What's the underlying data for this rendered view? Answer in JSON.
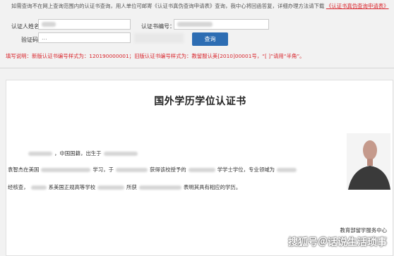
{
  "notice": {
    "text": "如需查询不在网上查询范围内的认证书查询，用人单位可邮寄《认证书真伪查询申请表》查询，我中心将回函答复，详细办理方法请下载",
    "link_label": "《认证书真伪查询申请表》"
  },
  "form": {
    "name_label": "认证人姓名：",
    "cert_no_label": "认证书编号：",
    "captcha_label": "验证码：",
    "captcha_value": "...",
    "search_label": "查询"
  },
  "hint": "填写说明：新版认证书编号样式为：120190000001；旧版认证书编号样式为：教留服认美[2010]00001号，“[ ]”请用“半角”。",
  "certificate": {
    "title": "国外学历学位认证书",
    "line1_a": "，中国国籍，出生于",
    "line2_a": "袁智杰在美国",
    "line2_b": "学习，于",
    "line2_c": "获得该校授予的",
    "line2_d": "学学士学位，专业领域为",
    "line3_a": "经核查，",
    "line3_b": "系美国正规高等学校",
    "line3_c": "所获",
    "line3_d": "表明其具有相应的学历。",
    "issuer": "教育部留学服务中心"
  },
  "watermark": "搜狐号＠话说生活琐事"
}
